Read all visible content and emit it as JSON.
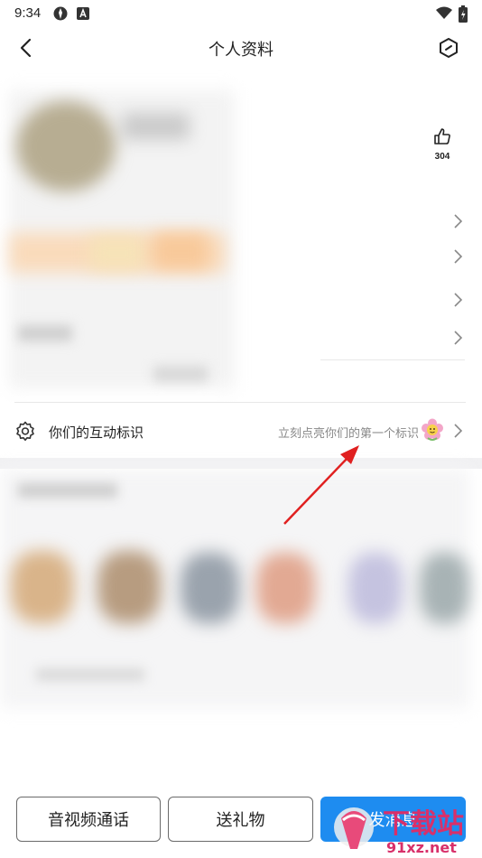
{
  "status_bar": {
    "time": "9:34"
  },
  "header": {
    "title": "个人资料"
  },
  "profile": {
    "like_count": "304"
  },
  "interaction": {
    "label": "你们的互动标识",
    "hint": "立刻点亮你们的第一个标识"
  },
  "actions": {
    "call_label": "音视频通话",
    "gift_label": "送礼物",
    "message_label": "发消息"
  },
  "watermark": {
    "text_main": "下载站",
    "text_sub": "91xz.net"
  },
  "colors": {
    "accent": "#1e8cf0",
    "arrow": "#e02020"
  }
}
